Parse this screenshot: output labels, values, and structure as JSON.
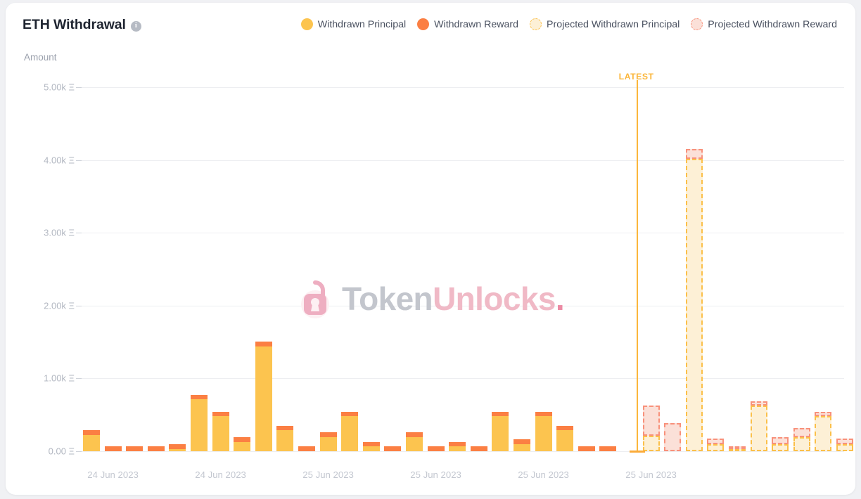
{
  "header": {
    "title": "ETH Withdrawal",
    "info_icon": "info-icon",
    "info_tooltip": "i"
  },
  "legend": [
    {
      "label": "Withdrawn Principal",
      "color": "#fcc44f",
      "style": "solid",
      "key": "withdrawn_principal"
    },
    {
      "label": "Withdrawn Reward",
      "color": "#fb7f43",
      "style": "solid",
      "key": "withdrawn_reward"
    },
    {
      "label": "Projected Withdrawn Principal",
      "color": "#fdf0d6",
      "border": "#fbc04a",
      "style": "dashed",
      "key": "projected_withdrawn_principal"
    },
    {
      "label": "Projected Withdrawn Reward",
      "color": "#fbe0d8",
      "border": "#f8917b",
      "style": "dashed",
      "key": "projected_withdrawn_reward"
    }
  ],
  "annotations": {
    "latest_label": "LATEST",
    "latest_color": "#fbb63b",
    "latest_index": 26
  },
  "watermark": {
    "text_primary": "Token",
    "text_secondary": "Unlocks",
    "text_dot": ".",
    "icon": "padlock-icon"
  },
  "chart_data": {
    "type": "bar",
    "title": "ETH Withdrawal",
    "xlabel": "",
    "ylabel": "Amount",
    "ylim": [
      0,
      5000
    ],
    "yticks": [
      0,
      1000,
      2000,
      3000,
      4000,
      5000
    ],
    "ytick_labels": [
      "0.00 Ξ",
      "1.00k Ξ",
      "2.00k Ξ",
      "3.00k Ξ",
      "4.00k Ξ",
      "5.00k Ξ"
    ],
    "grid": true,
    "stacked": true,
    "legend_position": "top-right",
    "unit": "Ξ",
    "xtick_labels": [
      "24 Jun 2023",
      "24 Jun 2023",
      "25 Jun 2023",
      "25 Jun 2023",
      "25 Jun 2023",
      "25 Jun 2023"
    ],
    "xtick_indices": [
      1,
      6,
      11,
      16,
      21,
      26
    ],
    "series": [
      {
        "name": "Withdrawn Principal",
        "key": "withdrawn_principal",
        "color": "#fcc44f",
        "values": [
          224,
          0,
          0,
          0,
          32,
          710,
          480,
          128,
          1440,
          288,
          0,
          192,
          480,
          64,
          0,
          192,
          0,
          64,
          0,
          480,
          96,
          480,
          288,
          0,
          0,
          0,
          null,
          null,
          null,
          null,
          null,
          null,
          null,
          null,
          null,
          null,
          null,
          null
        ]
      },
      {
        "name": "Withdrawn Reward",
        "key": "withdrawn_reward",
        "color": "#fb7f43",
        "values": [
          64,
          64,
          64,
          64,
          64,
          64,
          64,
          64,
          64,
          64,
          64,
          64,
          64,
          64,
          64,
          64,
          64,
          64,
          64,
          64,
          64,
          64,
          64,
          64,
          64,
          0,
          null,
          null,
          null,
          null,
          null,
          null,
          null,
          null,
          null,
          null,
          null,
          null
        ]
      },
      {
        "name": "Projected Withdrawn Principal",
        "key": "projected_withdrawn_principal",
        "color": "#fdf0d6",
        "border": "#fbc04a",
        "values": [
          null,
          null,
          null,
          null,
          null,
          null,
          null,
          null,
          null,
          null,
          null,
          null,
          null,
          null,
          null,
          null,
          null,
          null,
          null,
          null,
          null,
          null,
          null,
          null,
          null,
          null,
          208,
          0,
          4020,
          96,
          32,
          624,
          96,
          192,
          480,
          96,
          null,
          null
        ]
      },
      {
        "name": "Projected Withdrawn Reward",
        "key": "projected_withdrawn_reward",
        "color": "#fbe0d8",
        "border": "#f8917b",
        "values": [
          null,
          null,
          null,
          null,
          null,
          null,
          null,
          null,
          null,
          null,
          null,
          null,
          null,
          null,
          null,
          null,
          null,
          null,
          null,
          null,
          null,
          null,
          null,
          null,
          null,
          null,
          416,
          384,
          128,
          80,
          32,
          64,
          96,
          128,
          64,
          80,
          null,
          null
        ]
      }
    ],
    "bar_count": 36
  }
}
